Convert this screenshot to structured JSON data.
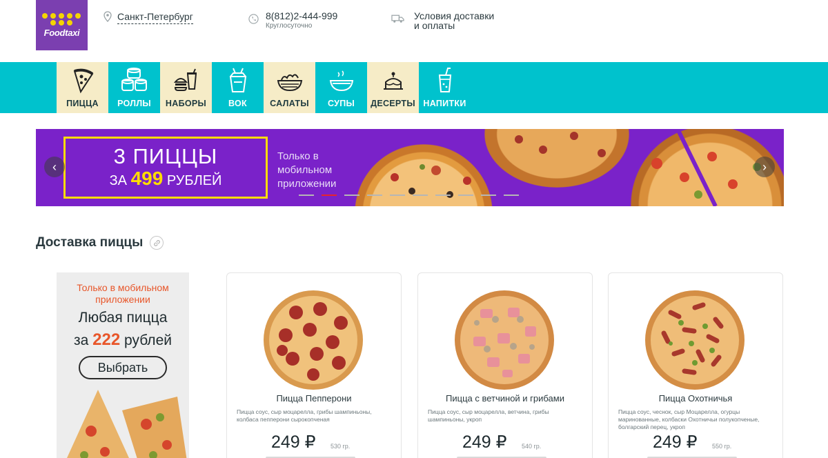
{
  "header": {
    "logo_text": "Foodtaxi",
    "city": "Санкт-Петербург",
    "phone": "8(812)2-444-999",
    "phone_hours": "Круглосуточно",
    "delivery_line1": "Условия доставки",
    "delivery_line2": "и оплаты"
  },
  "nav": {
    "items": [
      {
        "label": "ПИЦЦА",
        "icon": "pizza-slice-icon"
      },
      {
        "label": "РОЛЛЫ",
        "icon": "sushi-rolls-icon"
      },
      {
        "label": "НАБОРЫ",
        "icon": "combo-set-icon"
      },
      {
        "label": "ВОК",
        "icon": "wok-box-icon"
      },
      {
        "label": "САЛАТЫ",
        "icon": "salad-bowl-icon"
      },
      {
        "label": "СУПЫ",
        "icon": "soup-bowl-icon"
      },
      {
        "label": "ДЕСЕРТЫ",
        "icon": "dessert-cake-icon"
      },
      {
        "label": "НАПИТКИ",
        "icon": "drink-cup-icon"
      }
    ]
  },
  "banner": {
    "title": "3 ПИЦЦЫ",
    "price_prefix": "ЗА",
    "price": "499",
    "price_suffix": "РУБЛЕЙ",
    "side_text": "Только в мобильном приложении",
    "slides_total": 10,
    "active_slide": 2,
    "prev_arrow": "‹",
    "next_arrow": "›"
  },
  "section": {
    "title": "Доставка пиццы"
  },
  "side_promo": {
    "subtitle": "Только в мобильном приложении",
    "line1": "Любая пицца",
    "line2_prefix": "за",
    "line2_price": "222",
    "line2_suffix": "рублей",
    "button": "Выбрать"
  },
  "products": [
    {
      "name": "Пицца Пепперони",
      "description": "Пицца соус, сыр моцарелла, грибы шампиньоны, колбаса пепперони сырокопченая",
      "price": "249 ₽",
      "weight": "530 гр."
    },
    {
      "name": "Пицца с ветчиной и грибами",
      "description": "Пицца соус, сыр моцарелла, ветчина, грибы шампиньоны, укроп",
      "price": "249 ₽",
      "weight": "540 гр."
    },
    {
      "name": "Пицца Охотничья",
      "description": "Пицца соус, чеснок, сыр Моцарелла, огурцы маринованные, колбаски Охотничьи полукопченые, болгарский перец, укроп",
      "price": "249 ₽",
      "weight": "550 гр."
    }
  ],
  "colors": {
    "brand_purple": "#7b3fb0",
    "nav_teal": "#00c2cd",
    "nav_cream": "#f6ecc7",
    "banner_purple": "#7a22c9",
    "accent_yellow": "#ffdc00",
    "accent_orange": "#e8562a"
  }
}
